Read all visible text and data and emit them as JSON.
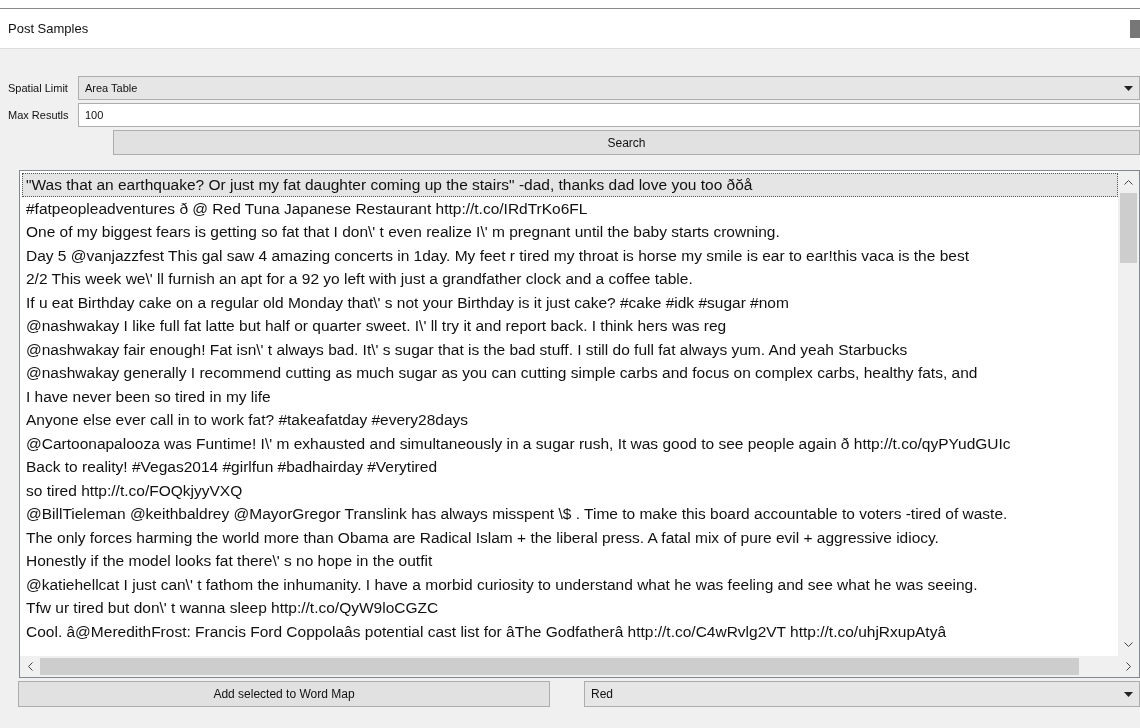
{
  "panel": {
    "title": "Post Samples"
  },
  "spatial_limit": {
    "label": "Spatial Limit",
    "value": "Area Table"
  },
  "max_results": {
    "label": "Max Resutls",
    "value": "100"
  },
  "search_button": "Search",
  "posts": [
    {
      "text": "\"Was that an earthquake? Or just my fat daughter coming up the stairs\" -dad, thanks dad love you too ðŏå",
      "selected": true
    },
    {
      "text": "#fatpeopleadventures ð @ Red Tuna Japanese Restaurant http://t.co/IRdTrKo6FL",
      "selected": false
    },
    {
      "text": "One of my biggest fears is getting so fat that I don\\' t even realize I\\' m pregnant until the baby starts crowning.",
      "selected": false
    },
    {
      "text": "Day 5 @vanjazzfest This gal saw 4 amazing concerts in 1day. My feet r tired my throat is horse my smile is ear to ear!this vaca is the best",
      "selected": false
    },
    {
      "text": "2/2 This week we\\' ll furnish an apt for a 92 yo left with just a grandfather clock and a coffee table.",
      "selected": false
    },
    {
      "text": "If u eat Birthday cake on a regular old Monday that\\' s not your Birthday is it just cake? #cake #idk #sugar #nom",
      "selected": false
    },
    {
      "text": "@nashwakay I like full fat latte but half or quarter sweet. I\\' ll try it and report back. I think hers was reg",
      "selected": false
    },
    {
      "text": "@nashwakay fair enough! Fat isn\\' t always bad. It\\' s sugar that is the bad stuff. I still do full fat always yum. And yeah Starbucks",
      "selected": false
    },
    {
      "text": "@nashwakay generally I recommend cutting as much sugar as you can cutting simple carbs and focus on complex carbs, healthy fats, and",
      "selected": false
    },
    {
      "text": "I have never been so tired in my life",
      "selected": false
    },
    {
      "text": "Anyone else ever call in to work fat? #takeafatday #every28days",
      "selected": false
    },
    {
      "text": "@Cartoonapalooza was Funtime! I\\' m exhausted and simultaneously in a sugar rush, It was good to see people again ð http://t.co/qyPYudGUIc",
      "selected": false
    },
    {
      "text": "Back to reality! #Vegas2014 #girlfun #badhairday #Verytired",
      "selected": false
    },
    {
      "text": "so tired http://t.co/FOQkjyyVXQ",
      "selected": false
    },
    {
      "text": "@BillTieleman @keithbaldrey @MayorGregor Translink has always misspent \\$ . Time to make this board accountable to voters -tired of waste.",
      "selected": false
    },
    {
      "text": "The only forces harming the world more than Obama are Radical Islam + the liberal press. A fatal mix of pure evil + aggressive idiocy.",
      "selected": false
    },
    {
      "text": "Honestly if the model looks fat there\\' s no hope in the outfit",
      "selected": false
    },
    {
      "text": "@katiehellcat I just can\\' t fathom the inhumanity. I have a morbid curiosity to understand what he was feeling and see what he was seeing.",
      "selected": false
    },
    {
      "text": "Tfw ur tired but don\\' t wanna sleep http://t.co/QyW9loCGZC",
      "selected": false
    },
    {
      "text": "Cool. â@MeredithFrost: Francis Ford Coppolaâs potential cast list for âThe Godfatherâ http://t.co/C4wRvlg2VT http://t.co/uhjRxupAtyâ",
      "selected": false
    }
  ],
  "add_button": "Add selected to Word Map",
  "color_select": {
    "value": "Red"
  }
}
